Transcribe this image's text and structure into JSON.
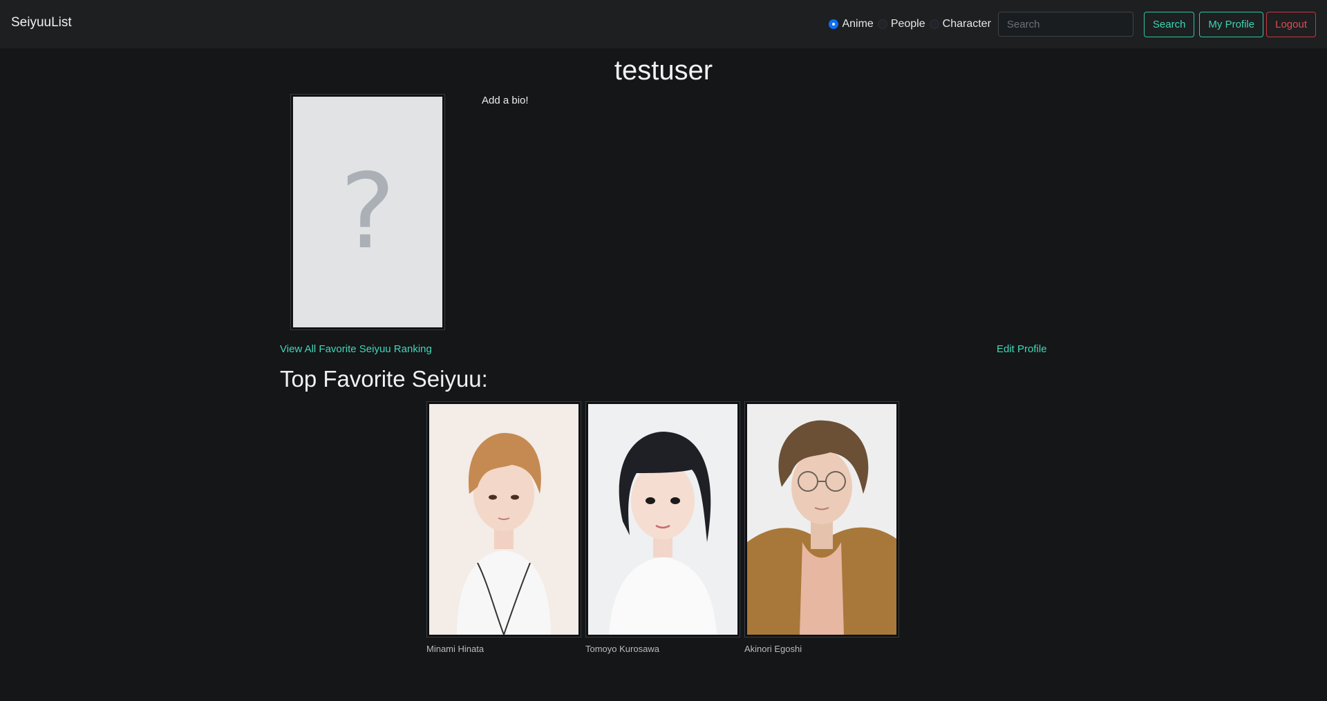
{
  "nav": {
    "brand": "SeiyuuList",
    "radios": [
      {
        "label": "Anime",
        "checked": true
      },
      {
        "label": "People",
        "checked": false
      },
      {
        "label": "Character",
        "checked": false
      }
    ],
    "search_placeholder": "Search",
    "search_button": "Search",
    "my_profile": "My Profile",
    "logout": "Logout"
  },
  "profile": {
    "username": "testuser",
    "avatar_icon": "question-mark-placeholder",
    "bio": "Add a bio!",
    "view_ranking_link": "View All Favorite Seiyuu Ranking",
    "edit_profile_link": "Edit Profile"
  },
  "favorites": {
    "title": "Top Favorite Seiyuu:",
    "items": [
      {
        "name": "Minami Hinata"
      },
      {
        "name": "Tomoyo Kurosawa"
      },
      {
        "name": "Akinori Egoshi"
      }
    ]
  },
  "colors": {
    "background": "#141618",
    "navbar": "#1d1f21",
    "accent_teal": "#39d7b3",
    "danger_red": "#e14b54",
    "radio_checked": "#0d6efd"
  }
}
